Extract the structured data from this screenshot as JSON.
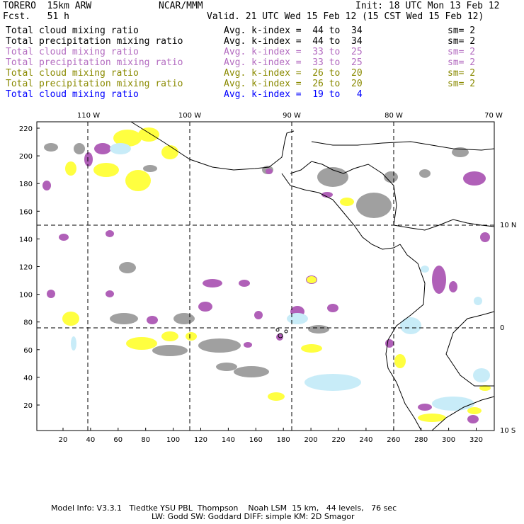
{
  "header": {
    "model": "TORERO  15km ARW",
    "org": "NCAR/MMM",
    "init": "Init: 18 UTC Mon 13 Feb 12",
    "fcst": "Fcst.   51 h",
    "valid": "Valid. 21 UTC Wed 15 Feb 12 (15 CST Wed 15 Feb 12)"
  },
  "legend": [
    {
      "field": "Total cloud mixing ratio",
      "range": "Avg. k-index =  44 to  34",
      "sm": "sm= 2",
      "color": "#000000"
    },
    {
      "field": "Total precipitation mixing ratio",
      "range": "Avg. k-index =  44 to  34",
      "sm": "sm= 2",
      "color": "#000000"
    },
    {
      "field": "Total cloud mixing ratio",
      "range": "Avg. k-index =  33 to  25",
      "sm": "sm= 2",
      "color": "#b36bc0"
    },
    {
      "field": "Total precipitation mixing ratio",
      "range": "Avg. k-index =  33 to  25",
      "sm": "sm= 2",
      "color": "#b36bc0"
    },
    {
      "field": "Total cloud mixing ratio",
      "range": "Avg. k-index =  26 to  20",
      "sm": "sm= 2",
      "color": "#8a8a00"
    },
    {
      "field": "Total precipitation mixing ratio",
      "range": "Avg. k-index =  26 to  20",
      "sm": "sm= 2",
      "color": "#8a8a00"
    },
    {
      "field": "Total cloud mixing ratio",
      "range": "Avg. k-index =  19 to   4",
      "sm": "",
      "color": "#0000ff"
    }
  ],
  "map": {
    "lon_labels": [
      "110 W",
      "100 W",
      "90 W",
      "80 W",
      "70 W"
    ],
    "lat_labels": [
      "10 N",
      "0",
      "10 S"
    ],
    "y_ticks": [
      "220",
      "200",
      "180",
      "160",
      "140",
      "120",
      "100",
      "80",
      "60",
      "40",
      "20"
    ],
    "x_ticks": [
      "20",
      "40",
      "60",
      "80",
      "100",
      "120",
      "140",
      "160",
      "180",
      "200",
      "220",
      "240",
      "260",
      "280",
      "300",
      "320"
    ],
    "colors": {
      "gray": "#a0a0a0",
      "purple": "#b060b8",
      "yellow": "#ffff40",
      "lightblue": "#c8ecf8"
    }
  },
  "footer": {
    "line1": "Model Info: V3.3.1   Tiedtke YSU PBL  Thompson    Noah LSM  15 km,   44 levels,   76 sec",
    "line2": "LW: Godd SW: Goddard DIFF: simple KM: 2D Smagor"
  }
}
